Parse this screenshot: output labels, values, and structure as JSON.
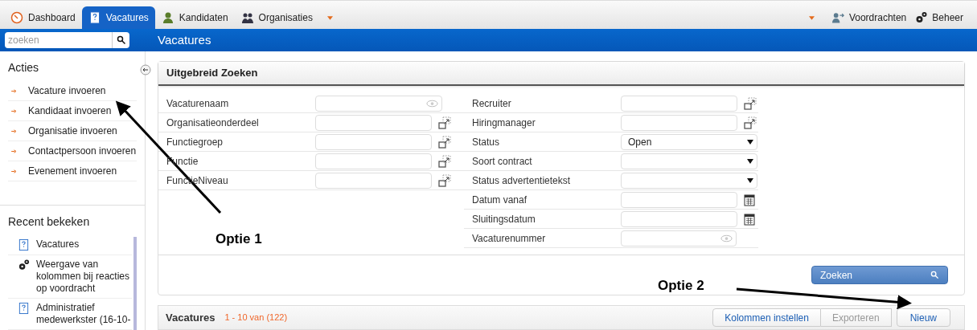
{
  "nav": {
    "tabs": [
      {
        "label": "Dashboard",
        "selected": false
      },
      {
        "label": "Vacatures",
        "selected": true
      },
      {
        "label": "Kandidaten",
        "selected": false
      },
      {
        "label": "Organisaties",
        "selected": false
      }
    ],
    "right_items": [
      "Voordrachten",
      "Beheer"
    ]
  },
  "search": {
    "placeholder": "zoeken"
  },
  "page_title": "Vacatures",
  "sidebar": {
    "actions_title": "Acties",
    "actions": [
      "Vacature invoeren",
      "Kandidaat invoeren",
      "Organisatie invoeren",
      "Contactpersoon invoeren",
      "Evenement invoeren"
    ],
    "recent_title": "Recent bekeken",
    "recent": [
      {
        "label": "Vacatures",
        "kind": "vacancy"
      },
      {
        "label": "Weergave van kolommen bij reacties op voordracht",
        "kind": "setting"
      },
      {
        "label": "Administratief medewerkster (16-10-",
        "kind": "vacancy"
      }
    ]
  },
  "search_panel": {
    "title": "Uitgebreid Zoeken",
    "left_fields": [
      {
        "label": "Vacaturenaam",
        "kind": "eye"
      },
      {
        "label": "Organisatieonderdeel",
        "kind": "lookup"
      },
      {
        "label": "Functiegroep",
        "kind": "lookup"
      },
      {
        "label": "Functie",
        "kind": "lookup"
      },
      {
        "label": "FunctieNiveau",
        "kind": "lookup"
      }
    ],
    "right_fields": [
      {
        "label": "Recruiter",
        "kind": "lookup"
      },
      {
        "label": "Hiringmanager",
        "kind": "lookup"
      },
      {
        "label": "Status",
        "kind": "select",
        "value": "Open"
      },
      {
        "label": "Soort contract",
        "kind": "select"
      },
      {
        "label": "Status advertentietekst",
        "kind": "select"
      },
      {
        "label": "Datum vanaf",
        "kind": "date"
      },
      {
        "label": "Sluitingsdatum",
        "kind": "date"
      },
      {
        "label": "Vacaturenummer",
        "kind": "eye"
      }
    ],
    "search_button": "Zoeken"
  },
  "results": {
    "title": "Vacatures",
    "count": "1 - 10 van (122)",
    "buttons": [
      {
        "label": "Kolommen instellen",
        "disabled": false
      },
      {
        "label": "Exporteren",
        "disabled": true
      },
      {
        "label": "Nieuw",
        "disabled": false
      }
    ]
  },
  "annotations": [
    "Optie 1",
    "Optie 2"
  ]
}
